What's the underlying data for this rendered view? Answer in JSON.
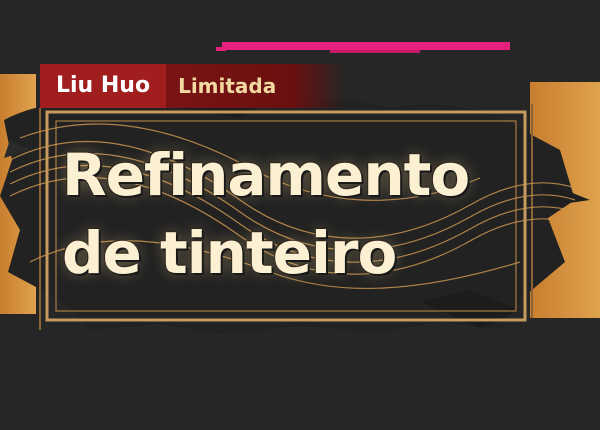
{
  "banner": {
    "character_tag": "Liu Huo",
    "wish_type": "Limitada",
    "title_line1": "Refinamento",
    "title_line2": "de tinteiro"
  },
  "colors": {
    "background": "#262626",
    "character_tag_bg": "#a11e1e",
    "wish_type_bg": "#7a1414",
    "accent_magenta": "#e8207e",
    "frame_gold": "#c79a5e",
    "title_text": "#fbf1d2"
  },
  "icons": [
    "ink-splash-icon",
    "wave-lines-icon"
  ]
}
